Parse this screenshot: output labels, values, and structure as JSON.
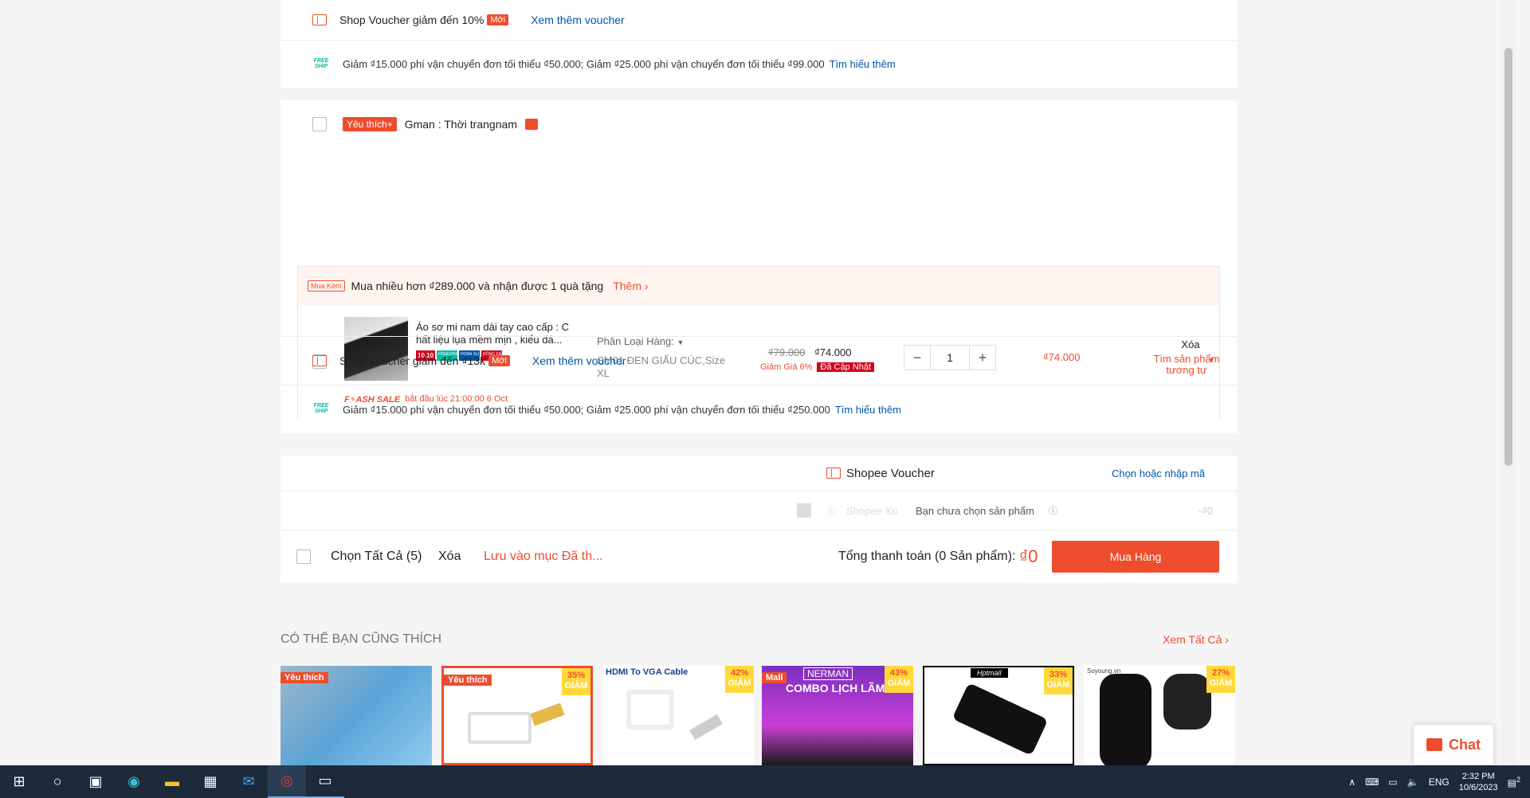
{
  "shop1": {
    "voucher_text": "Shop Voucher giảm đến 10%",
    "voucher_badge": "Mới",
    "voucher_link": "Xem thêm voucher",
    "freeship_text": "Giảm ₫15.000 phí vận chuyển đơn tối thiểu ₫50.000; Giảm ₫25.000 phí vận chuyển đơn tối thiểu ₫99.000",
    "freeship_link": "Tìm hiểu thêm"
  },
  "shop2": {
    "tag": "Yêu thích+",
    "name": "Gman : Thời trangnam",
    "addon": {
      "label": "Mua Kèm",
      "text": "Mua nhiều hơn ₫289.000 và nhận được 1 quà tặng",
      "link": "Thêm"
    },
    "product": {
      "name": "Áo sơ mi nam dài tay cao cấp : C hất liệu lụa mềm mịn , kiểu dá...",
      "badges": [
        "10.10",
        "FREESHIP XTRA",
        "HOÀN XU XTRA",
        "ĐÔNG KIỂM"
      ],
      "variant_label": "Phân Loại Hàng:",
      "variant_value": "SM01 ĐEN GIẤU CÚC,Size XL",
      "old_price": "₫79.000",
      "price": "₫74.000",
      "discount": "Giảm Giá 6%",
      "updated": "Đã Cập Nhật",
      "qty": "1",
      "qty_minus": "−",
      "qty_plus": "+",
      "total": "₫74.000",
      "delete": "Xóa",
      "similar": "Tìm sản phẩm tương tự",
      "flash_logo": "F⚡ASH SALE",
      "flash_text": "bắt đầu lúc 21:00:00 6 Oct"
    },
    "voucher_text": "Shop Voucher giảm đến ₫13k",
    "voucher_badge": "Mới",
    "voucher_link": "Xem thêm voucher",
    "freeship_text": "Giảm ₫15.000 phí vận chuyển đơn tối thiểu ₫50.000; Giảm ₫25.000 phí vận chuyển đơn tối thiểu ₫250.000",
    "freeship_link": "Tìm hiểu thêm"
  },
  "freeship_icon": "FREE SHIP",
  "summary": {
    "shopee_voucher": "Shopee Voucher",
    "voucher_link": "Chọn hoặc nhập mã",
    "xu_label": "Shopee Xu",
    "xu_note": "Bạn chưa chọn sản phẩm",
    "xu_value": "-₫0",
    "select_all": "Chọn Tất Cả (5)",
    "delete": "Xóa",
    "save": "Lưu vào mục Đã th...",
    "total_label": "Tổng thanh toán (0 Sản phẩm):",
    "total_value": "₫0",
    "buy": "Mua Hàng"
  },
  "recommend": {
    "title": "CÓ THỂ BẠN CŨNG THÍCH",
    "see_all": "Xem Tất Cả",
    "tiles": [
      {
        "tag": "Yêu thích",
        "discount": "",
        "caption": ""
      },
      {
        "tag": "Yêu thích",
        "discount": "35%",
        "caption": ""
      },
      {
        "tag": "",
        "discount": "42%",
        "caption": "HDMI To VGA Cable"
      },
      {
        "tag": "Mall",
        "discount": "43%",
        "caption": "COMBO LỊCH LÃM"
      },
      {
        "tag": "",
        "discount": "33%",
        "caption": "Hptmall"
      },
      {
        "tag": "",
        "discount": "27%",
        "caption": "Soyoung.vn"
      }
    ],
    "discount_word": "GIẢM",
    "nerman": "NERMAN"
  },
  "chat": {
    "label": "Chat"
  },
  "taskbar": {
    "time": "2:32 PM",
    "date": "10/6/2023",
    "lang": "ENG",
    "notif_count": "2"
  }
}
